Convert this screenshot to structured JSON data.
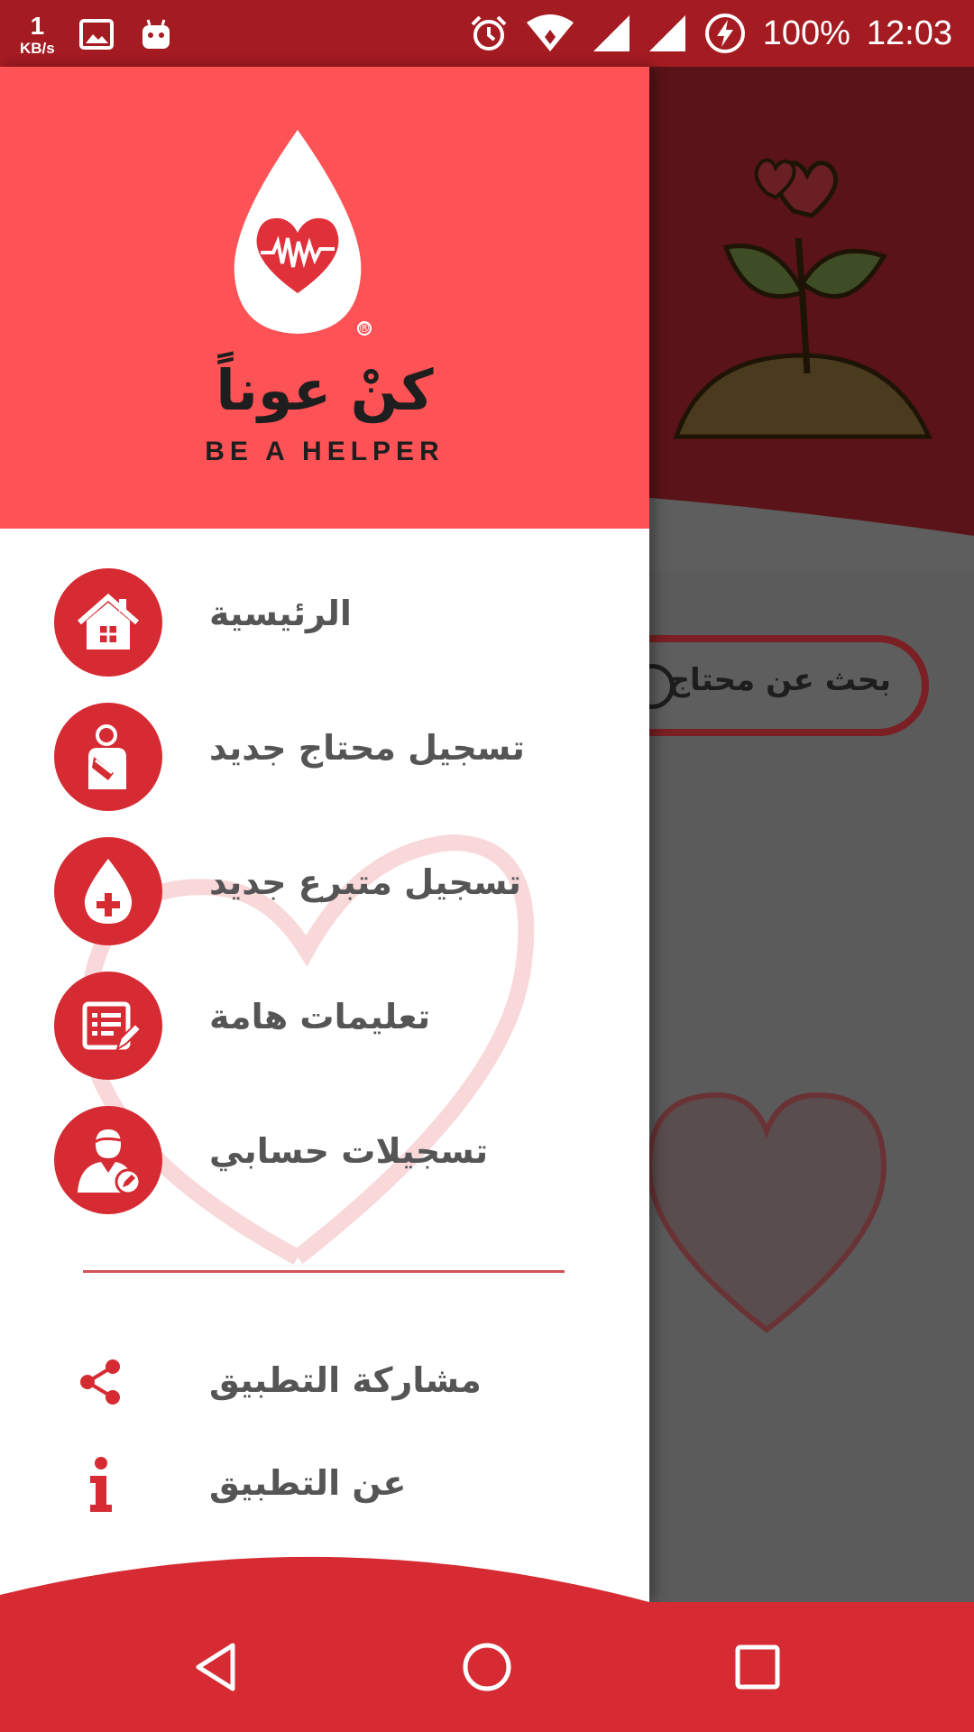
{
  "status_bar": {
    "speed_value": "1",
    "speed_unit": "KB/s",
    "battery": "100%",
    "time": "12:03",
    "icons": [
      "image-icon",
      "android-icon",
      "alarm-icon",
      "wifi-icon",
      "signal-icon",
      "signal-icon",
      "charging-icon"
    ]
  },
  "drawer": {
    "logo_arabic": "كنْ عوناً",
    "logo_english": "BE A HELPER",
    "menu": [
      {
        "label": "الرئيسية",
        "icon": "home-icon"
      },
      {
        "label": "تسجيل محتاج جديد",
        "icon": "patient-icon"
      },
      {
        "label": "تسجيل متبرع جديد",
        "icon": "blood-drop-icon"
      },
      {
        "label": "تعليمات هامة",
        "icon": "document-edit-icon"
      },
      {
        "label": "تسجيلات حسابي",
        "icon": "user-edit-icon"
      }
    ],
    "secondary": [
      {
        "label": "مشاركة التطبيق",
        "icon": "share-icon"
      },
      {
        "label": "عن التطبيق",
        "icon": "info-icon"
      }
    ]
  },
  "background": {
    "search_text": "بحث عن   محتاج"
  },
  "nav_bar": {
    "icons": [
      "back-icon",
      "home-circle-icon",
      "recents-icon"
    ]
  },
  "colors": {
    "status_bar": "#a51b22",
    "header": "#fd5356",
    "accent": "#d62b33",
    "label": "#555555"
  }
}
